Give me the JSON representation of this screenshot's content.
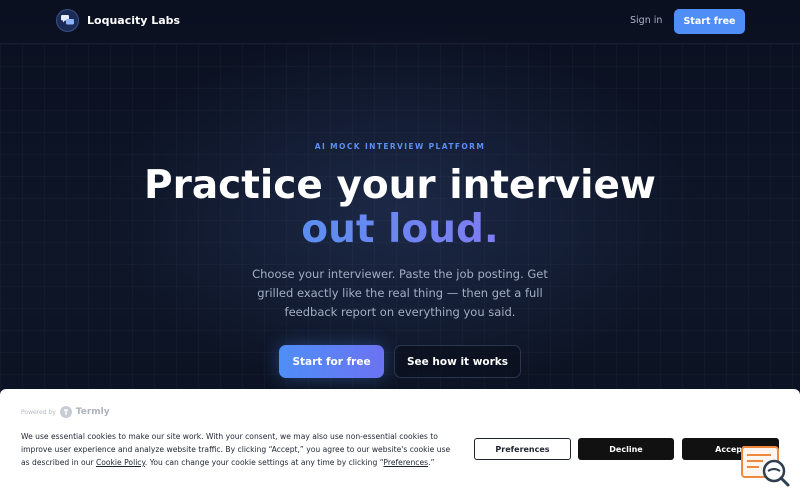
{
  "header": {
    "brand_name": "Loquacity Labs",
    "logo_icon": "chat-bubbles-icon",
    "signin_label": "Sign in",
    "start_free_label": "Start free"
  },
  "hero": {
    "eyebrow": "AI MOCK INTERVIEW PLATFORM",
    "headline": "Practice your interview",
    "headline_accent": "out loud.",
    "subtext": "Choose your interviewer. Paste the job posting. Get grilled exactly like the real thing — then get a full feedback report on everything you said.",
    "cta_primary": "Start for free",
    "cta_secondary": "See how it works"
  },
  "cookie_banner": {
    "powered_by": "Powered by",
    "provider": "Termly",
    "text_part1": "We use essential cookies to make our site work. With your consent, we may also use non-essential cookies to improve user experience and analyze website traffic. By clicking “Accept,” you agree to our website's cookie use as described in our ",
    "cookie_policy_link": "Cookie Policy",
    "text_part2": ". You can change your cookie settings at any time by clicking “",
    "preferences_link": "Preferences",
    "text_part3": ".”",
    "preferences_label": "Preferences",
    "decline_label": "Decline",
    "accept_label": "Accept",
    "floating_icon": "cookie-preferences-search-icon"
  },
  "colors": {
    "background": "#0b1120",
    "accent_blue": "#4f8ef7",
    "accent_violet": "#7f7cf3",
    "eyebrow": "#5b8ff0",
    "floating_icon": "#f0883e"
  }
}
